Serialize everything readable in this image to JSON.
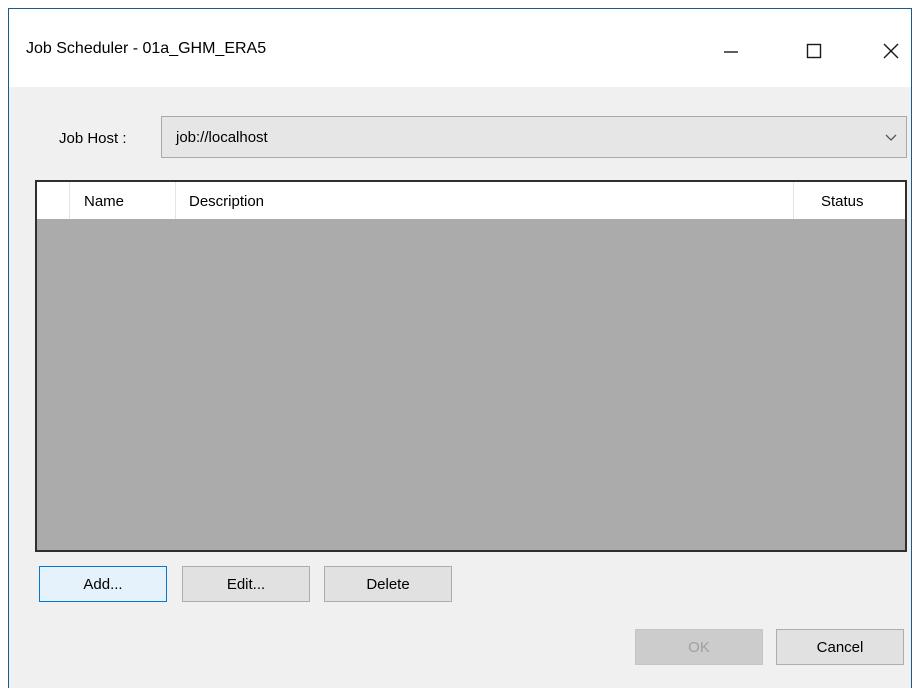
{
  "window": {
    "title": "Job Scheduler - 01a_GHM_ERA5",
    "controls": [
      "minimize-icon",
      "maximize-icon",
      "close-icon"
    ]
  },
  "job_host": {
    "label": "Job Host :",
    "value": "job://localhost"
  },
  "jobs_table": {
    "columns": [
      "",
      "Name",
      "Description",
      "Status"
    ],
    "rows": []
  },
  "buttons": {
    "add": "Add...",
    "edit": "Edit...",
    "delete": "Delete",
    "ok": "OK",
    "cancel": "Cancel"
  },
  "colors": {
    "accent": "#0078d7",
    "list_background": "#ababab",
    "window_background": "#f0f0f0"
  }
}
